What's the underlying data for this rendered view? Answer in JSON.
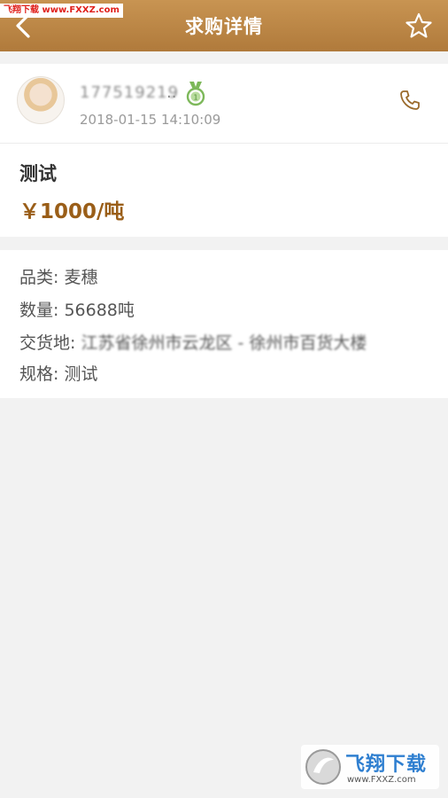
{
  "watermark": {
    "top": "飞翔下载 www.FXXZ.com",
    "bottom_brand": "飞翔下载",
    "bottom_url": "www.FXXZ.com"
  },
  "navbar": {
    "title": "求购详情",
    "back_icon": "chevron-left-icon",
    "favorite_icon": "star-outline-icon"
  },
  "user": {
    "name": "177519219",
    "name_suffix": "..",
    "medal_icon": "medal-icon",
    "timestamp": "2018-01-15 14:10:09",
    "call_icon": "phone-icon"
  },
  "item": {
    "title": "测试",
    "price": "￥1000/吨"
  },
  "details": {
    "category_label": "品类:",
    "category_value": "麦穗",
    "quantity_label": "数量:",
    "quantity_value": "56688吨",
    "location_label": "交货地:",
    "location_value": "江苏省徐州市云龙区 - 徐州市百货大楼",
    "spec_label": "规格:",
    "spec_value": "测试"
  },
  "colors": {
    "header": "#b98343",
    "price": "#9a5e18",
    "medal": "#7db85a"
  }
}
